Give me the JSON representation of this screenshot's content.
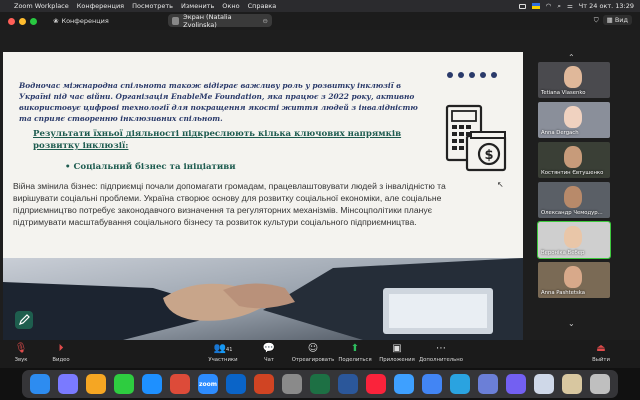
{
  "menubar": {
    "app": "Zoom Workplace",
    "items": [
      "Конференция",
      "Посмотреть",
      "Изменить",
      "Окно",
      "Справка"
    ],
    "clock": "Чт 24 окт. 13:29"
  },
  "zoom": {
    "meeting_label": "Конференция",
    "share_label": "Экран (Natalia Zvolinska)",
    "view_label": "Вид"
  },
  "slide": {
    "intro": "Водночас міжнародна спільнота також відіграє важливу роль у розвитку інклюзії в Україні під час війни. Організація EnableMe Foundation, яка працює з 2022 року, активно використовує цифрові технології для покращення якості життя людей з інвалідністю та сприяє створенню інклюзивних спільнот.",
    "heading": "Результати їхньої діяльності підкреслюють кілька ключових напрямків розвитку інклюзії:",
    "bullet": "Соціальний бізнес та ініціативи",
    "body": "Війна змінила бізнес: підприємці почали допомагати громадам, працевлаштовувати людей з інвалідністю та вирішувати соціальні проблеми. Україна створює основу для розвитку соціальної економіки, але соціальне підприємництво потребує законодавчого визначення та регуляторних механізмів. Мінсоцполітики планує підтримувати масштабування соціального бізнесу та розвиток культури соціального підприємництва."
  },
  "participants": [
    {
      "name": "Tetiana Vlasenko",
      "bg": "#4a4a4e",
      "skin": "#e0b89a"
    },
    {
      "name": "Anna Dergach",
      "bg": "#8a8f9a",
      "skin": "#f0d2c0"
    },
    {
      "name": "Костянтин Євтушенко",
      "bg": "#3a3f36",
      "skin": "#c79b7a"
    },
    {
      "name": "Олександр Чемодур...",
      "bg": "#5a5f66",
      "skin": "#b88a6a"
    },
    {
      "name": "Вероніка Вебер",
      "bg": "#cfcfcf",
      "skin": "#e9c6a8"
    },
    {
      "name": "Anna Pashtetska",
      "bg": "#7a6a55",
      "skin": "#d8a98a"
    }
  ],
  "toolbar": {
    "audio": "Звук",
    "video": "Видео",
    "participants": "Участники",
    "participants_count": "41",
    "chat": "Чат",
    "react": "Отреагировать",
    "share": "Поделиться",
    "apps": "Приложения",
    "more": "Дополнительно",
    "leave": "Выйти"
  },
  "dock": [
    {
      "name": "finder",
      "color": "#2d8cf0",
      "label": ""
    },
    {
      "name": "launchpad",
      "color": "#7a7aff",
      "label": ""
    },
    {
      "name": "photos",
      "color": "#f5a623",
      "label": ""
    },
    {
      "name": "facetime",
      "color": "#2ecc40",
      "label": ""
    },
    {
      "name": "app-store",
      "color": "#1e90ff",
      "label": ""
    },
    {
      "name": "chrome",
      "color": "#dd4b39",
      "label": ""
    },
    {
      "name": "zoom",
      "color": "#2d8cff",
      "label": "zoom"
    },
    {
      "name": "outlook",
      "color": "#0a64c8",
      "label": ""
    },
    {
      "name": "powerpoint",
      "color": "#d04423",
      "label": ""
    },
    {
      "name": "settings",
      "color": "#8a8a8a",
      "label": ""
    },
    {
      "name": "excel",
      "color": "#1d7044",
      "label": ""
    },
    {
      "name": "word",
      "color": "#2b579a",
      "label": ""
    },
    {
      "name": "music",
      "color": "#fa233b",
      "label": ""
    },
    {
      "name": "mail",
      "color": "#3ea0ff",
      "label": ""
    },
    {
      "name": "browser",
      "color": "#4285f4",
      "label": ""
    },
    {
      "name": "telegram",
      "color": "#2aa3e0",
      "label": ""
    },
    {
      "name": "preview",
      "color": "#6b7fd7",
      "label": ""
    },
    {
      "name": "viber",
      "color": "#7360f2",
      "label": ""
    },
    {
      "name": "finder-window",
      "color": "#cfd8e8",
      "label": ""
    },
    {
      "name": "notes",
      "color": "#d8c7a0",
      "label": ""
    },
    {
      "name": "trash",
      "color": "#bfbfbf",
      "label": ""
    }
  ]
}
